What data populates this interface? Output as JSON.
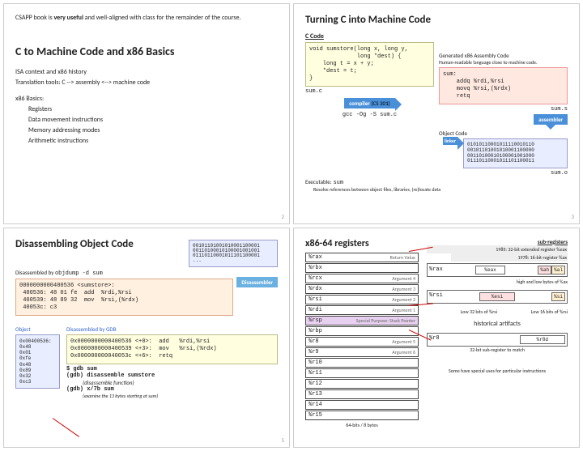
{
  "s1": {
    "note_pre": "CSAPP book is ",
    "note_b": "very useful",
    "note_post": " and well-aligned with class for the remainder of the course.",
    "title": "C to Machine Code and x86 Basics",
    "l1": "ISA context and x86 history",
    "l2": "Translation tools: C --> assembly <--> machine code",
    "l3": "x86 Basics:",
    "l4": "Registers",
    "l5": "Data movement instructions",
    "l6": "Memory addressing modes",
    "l7": "Arithmetic instructions",
    "pn": "2"
  },
  "s2": {
    "title": "Turning C into Machine Code",
    "sub1": "C Code",
    "code": "void sumstore(long x, long y,\n              long *dest) {\n    long t = x + y;\n    *dest = t;\n}",
    "fn1": "sum.c",
    "gcc": "gcc -Og -S sum.c",
    "comp": "compiler",
    "cs": "(CS 301)",
    "gen": "Generated x86 Assembly Code",
    "gen2": "Human-readable language close to machine code.",
    "asm": "sum:\n    addq %rdi,%rsi\n    movq %rsi,(%rdx)\n    retq",
    "fn2": "sum.s",
    "asmb": "assembler",
    "obj": "Object Code",
    "bits": "01010110001011110010110\n00101101001010001100000\n00110100010100001001000\n01110110001011101100011",
    "fn3": "sum.o",
    "link": "linker",
    "exe": "Executable:",
    "sum": "sum",
    "res": "Resolve references between object files, libraries, (re)locate data",
    "pn": "3"
  },
  "s3": {
    "title": "Disassembling Object Code",
    "dis": "Disassembled by ",
    "ojd": "objdump -d sum",
    "bits": "00101101001010001100001\n00110100010100001001001\n01110110001011101100001\n...",
    "dbox": "0000000000400536 <sumstore>:\n 400536: 48 01 fe  add  %rdi,%rsi\n 400539: 48 89 32  mov  %rsi,(%rdx)\n 40053c: c3",
    "da": "Disassembler",
    "objh": "Object",
    "gdh": "Disassembled by GDB",
    "hex": "0x00400536:\n0x48\n0x01\n0xfe\n0x48\n0x89\n0x32\n0xc3",
    "g1": "0x0000000000400536 <+0>:  add   %rdi,%rsi\n0x0000000000400539 <+3>:  mov   %rsi,(%rdx)\n0x000000000040053c <+6>:  retq",
    "g2": "$ gdb sum",
    "g3": "(gdb) disassemble sumstore",
    "g4": "(disassemble function)",
    "g5": "(gdb) x/7b sum",
    "g6": "(examine the 13 bytes starting at sum)",
    "pn": "5"
  },
  "s4": {
    "title": "x86-64 registers",
    "sub": "sub-registers",
    "h1": "1985: 32-bit extended register %eax",
    "h2": "1978: 16-bit register %ax",
    "hl": "high and low bytes of %ax",
    "esi": "Low 32 bits of %rsi",
    "si": "Low 16 bits of %rsi",
    "hist": "historical artifacts",
    "r8d": "32-bit sub-register to match",
    "ftr": "64-bits / 8 bytes",
    "ftr2": "Some have special uses for particular instructions",
    "regs": [
      {
        "n": "%rax",
        "d": "Return Value"
      },
      {
        "n": "%rbx",
        "d": ""
      },
      {
        "n": "%rcx",
        "d": "Argument 4"
      },
      {
        "n": "%rdx",
        "d": "Argument 3"
      },
      {
        "n": "%rsi",
        "d": "Argument 2"
      },
      {
        "n": "%rdi",
        "d": "Argument 1"
      },
      {
        "n": "%rsp",
        "d": "Special Purpose: Stack Pointer",
        "p": true
      },
      {
        "n": "%rbp",
        "d": ""
      },
      {
        "n": "%r8",
        "d": "Argument 5"
      },
      {
        "n": "%r9",
        "d": "Argument 6"
      },
      {
        "n": "%r10",
        "d": ""
      },
      {
        "n": "%r11",
        "d": ""
      },
      {
        "n": "%r12",
        "d": ""
      },
      {
        "n": "%r13",
        "d": ""
      },
      {
        "n": "%r14",
        "d": ""
      },
      {
        "n": "%r15",
        "d": ""
      }
    ]
  }
}
